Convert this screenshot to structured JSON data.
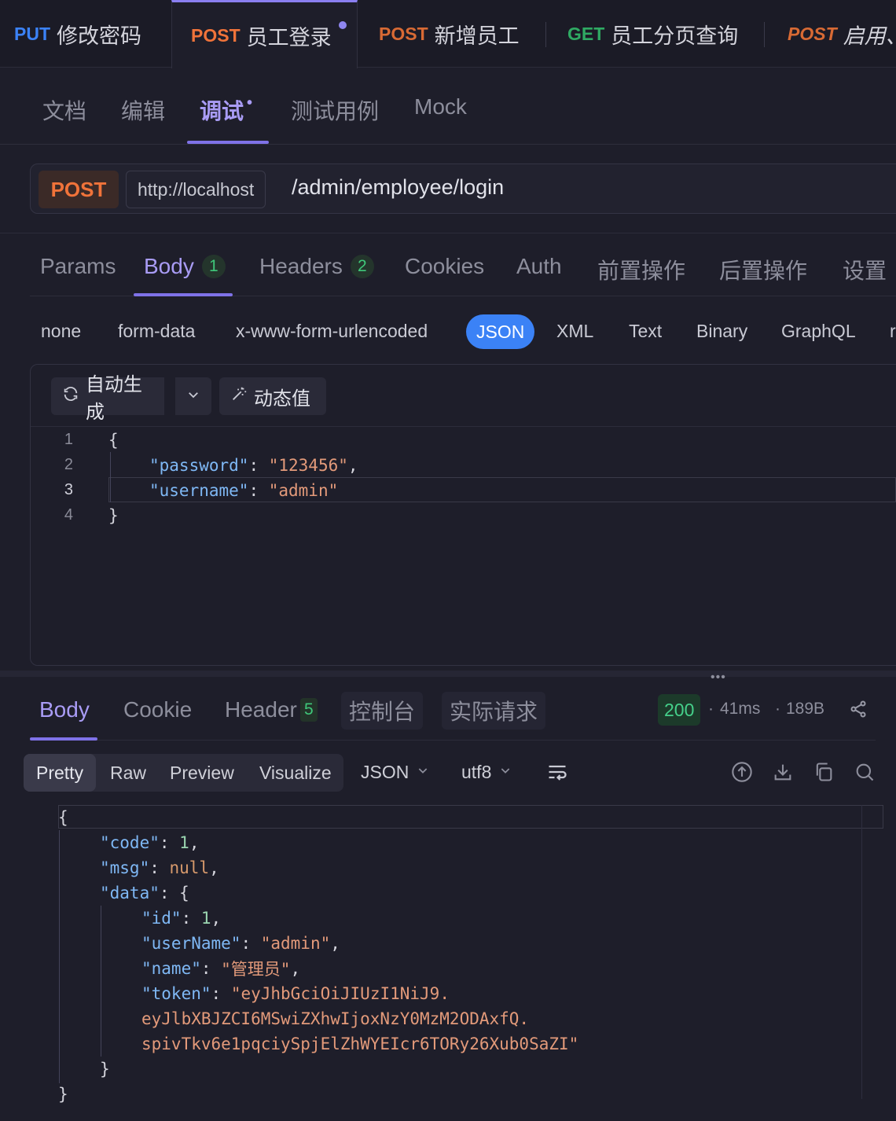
{
  "request_tabs": [
    {
      "method": "PUT",
      "title": "修改密码",
      "method_color": "#3b82f6"
    },
    {
      "method": "POST",
      "title": "员工登录",
      "method_color": "#f0733a",
      "active": true,
      "dirty": true
    },
    {
      "method": "POST",
      "title": "新增员工",
      "method_color": "#d86a34"
    },
    {
      "method": "GET",
      "title": "员工分页查询",
      "method_color": "#2faa63"
    },
    {
      "method": "POST",
      "title": "启用、",
      "method_color": "#d86a34"
    }
  ],
  "sub_tabs": [
    "文档",
    "编辑",
    "调试",
    "测试用例",
    "Mock"
  ],
  "sub_tab_dirty": "•",
  "url": {
    "method": "POST",
    "host": "http://localhost",
    "path": "/admin/employee/login"
  },
  "param_tabs": [
    {
      "label": "Params"
    },
    {
      "label": "Body",
      "count": "1"
    },
    {
      "label": "Headers",
      "count": "2"
    },
    {
      "label": "Cookies"
    },
    {
      "label": "Auth"
    },
    {
      "label": "前置操作"
    },
    {
      "label": "后置操作"
    },
    {
      "label": "设置"
    }
  ],
  "body_types": [
    "none",
    "form-data",
    "x-www-form-urlencoded",
    "JSON",
    "XML",
    "Text",
    "Binary",
    "GraphQL",
    "r"
  ],
  "editor_toolbar": {
    "auto_generate": "自动生成",
    "dynamic_value": "动态值"
  },
  "request_body": {
    "line_numbers": [
      "1",
      "2",
      "3",
      "4"
    ],
    "open": "{",
    "close": "}",
    "fields": [
      {
        "key": "\"password\"",
        "value": "\"123456\"",
        "comma": ","
      },
      {
        "key": "\"username\"",
        "value": "\"admin\"",
        "comma": ""
      }
    ]
  },
  "response_tabs": [
    {
      "label": "Body"
    },
    {
      "label": "Cookie"
    },
    {
      "label": "Header",
      "count": "5"
    },
    {
      "label": "控制台"
    },
    {
      "label": "实际请求"
    }
  ],
  "response_meta": {
    "status": "200",
    "time": "41ms",
    "size": "189B",
    "dot": "·"
  },
  "format_tabs": [
    "Pretty",
    "Raw",
    "Preview",
    "Visualize"
  ],
  "response_format": "JSON",
  "encoding": "utf8",
  "response_body": {
    "open": "{",
    "code_key": "\"code\"",
    "code_val": "1",
    "msg_key": "\"msg\"",
    "msg_val": "null",
    "data_key": "\"data\"",
    "id_key": "\"id\"",
    "id_val": "1",
    "username_key": "\"userName\"",
    "username_val": "\"admin\"",
    "name_key": "\"name\"",
    "name_val": "\"管理员\"",
    "token_key": "\"token\"",
    "token_lines": [
      "\"eyJhbGciOiJIUzI1NiJ9.",
      "eyJlbXBJZCI6MSwiZXhwIjoxNzY0MzM2ODAxfQ.",
      "spivTkv6e1pqciySpjElZhWYEIcr6TORy26Xub0SaZI\""
    ],
    "inner_close": "}",
    "close": "}"
  },
  "icons": {
    "refresh": "refresh-icon",
    "chevron": "chevron-down-icon",
    "magic": "magic-wand-icon",
    "share": "share-icon",
    "wrap": "wrap-lines-icon",
    "upload": "upload-icon",
    "download": "download-icon",
    "copy": "copy-icon",
    "search": "search-icon"
  },
  "colors": {
    "accent": "#8a7ff0",
    "json_pill": "#3b82f6",
    "success": "#45d08a"
  }
}
